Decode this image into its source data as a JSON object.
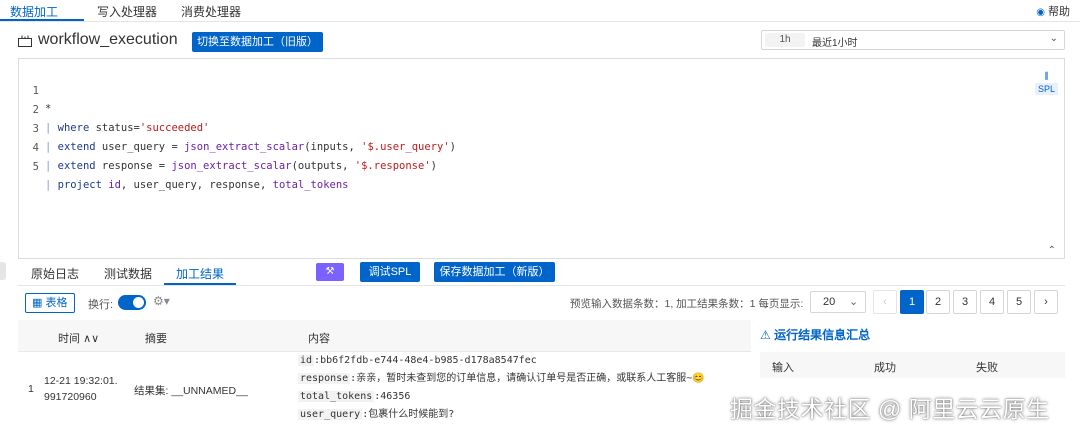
{
  "top_tabs": [
    "数据加工",
    "写入处理器",
    "消费处理器"
  ],
  "help_label": "帮助",
  "workflow_title": "workflow_execution",
  "switch_button": "切换至数据加工（旧版）",
  "time_range": {
    "pill": "1h",
    "text": "最近1小时"
  },
  "code_lines": [
    {
      "num": "1",
      "pre": "*"
    },
    {
      "num": "2",
      "pipe": "|",
      "kw": "where",
      "rest1": " status=",
      "str": "'succeeded'"
    },
    {
      "num": "3",
      "pipe": "|",
      "kw": "extend",
      "rest1": " user_query = ",
      "fn": "json_extract_scalar",
      "rest2": "(inputs, ",
      "str": "'$.user_query'",
      "rest3": ")"
    },
    {
      "num": "4",
      "pipe": "|",
      "kw": "extend",
      "rest1": " response = ",
      "fn": "json_extract_scalar",
      "rest2": "(outputs, ",
      "str": "'$.response'",
      "rest3": ")"
    },
    {
      "num": "5",
      "pipe": "|",
      "kw": "project",
      "rest1": " ",
      "fn": "id",
      "rest2": ", user_query, response, ",
      "fn2": "total_tokens"
    }
  ],
  "spl_tag": "SPL",
  "bottom_tabs": [
    "原始日志",
    "测试数据",
    "加工结果"
  ],
  "debug_button": "调试SPL",
  "save_button": "保存数据加工（新版）",
  "toolbar": {
    "table_label": "表格",
    "wrap_label": "换行:",
    "preview_text": "预览输入数据条数：1, 加工结果条数：1  每页显示:",
    "page_size": "20",
    "pages": [
      "1",
      "2",
      "3",
      "4",
      "5"
    ]
  },
  "table": {
    "headers": {
      "time": "时间",
      "summary": "摘要",
      "content": "内容"
    },
    "rows": [
      {
        "index": "1",
        "time_line1": "12-21 19:32:01.",
        "time_line2": "991720960",
        "summary": "结果集:  __UNNAMED__",
        "fields": [
          {
            "key": "id",
            "value": ":bb6f2fdb-e744-48e4-b985-d178a8547fec"
          },
          {
            "key": "response",
            "value": ":亲亲，暂时未查到您的订单信息，请确认订单号是否正确，或联系人工客服~😊"
          },
          {
            "key": "total_tokens",
            "value": ":46356"
          },
          {
            "key": "user_query",
            "value": ":包裹什么时候能到?"
          }
        ]
      }
    ]
  },
  "side_panel": {
    "title": "运行结果信息汇总",
    "headers": [
      "输入",
      "成功",
      "失败"
    ]
  },
  "watermark": "掘金技术社区 @ 阿里云云原生",
  "colors": {
    "primary": "#0064c8",
    "magic": "#7b61ff"
  }
}
